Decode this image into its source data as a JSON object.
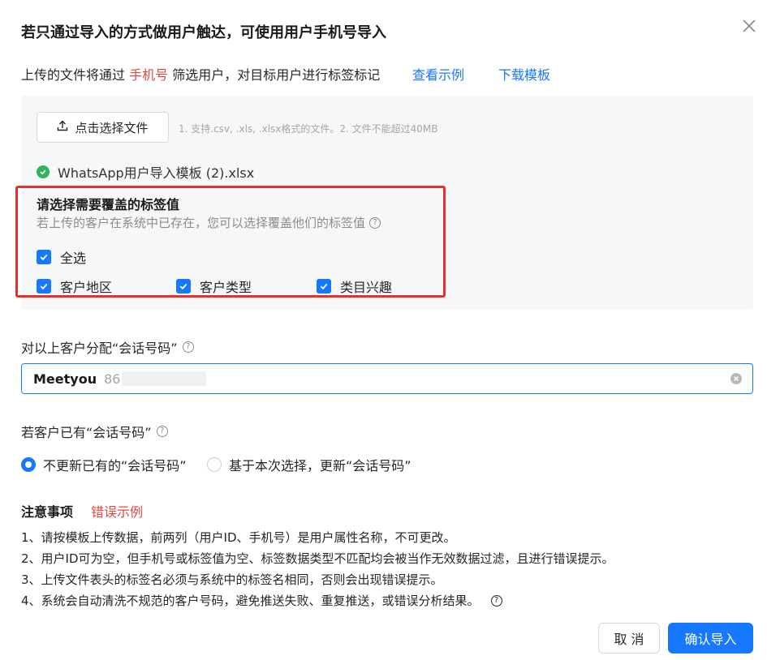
{
  "dialog": {
    "title": "若只通过导入的方式做用户触达，可使用用户手机号导入",
    "intro_prefix": "上传的文件将通过 ",
    "intro_highlight": "手机号",
    "intro_suffix": " 筛选用户，对目标用户进行标签标记",
    "view_example": "查看示例",
    "download_template": "下载模板"
  },
  "upload": {
    "button_label": "点击选择文件",
    "hint": "1. 支持.csv, .xls, .xlsx格式的文件。2. 文件不能超过40MB",
    "file_name": "WhatsApp用户导入模板 (2).xlsx"
  },
  "tags": {
    "title": "请选择需要覆盖的标签值",
    "description": "若上传的客户在系统中已存在，您可以选择覆盖他们的标签值",
    "select_all": "全选",
    "options": [
      "客户地区",
      "客户类型",
      "类目兴趣"
    ]
  },
  "assign": {
    "label": "对以上客户分配“会话号码”",
    "selected_name": "Meetyou",
    "selected_number_prefix": "86"
  },
  "existing": {
    "label": "若客户已有“会话号码”",
    "options": [
      "不更新已有的“会话号码”",
      "基于本次选择，更新“会话号码”"
    ],
    "selected_index": 0
  },
  "notes": {
    "title": "注意事项",
    "error_example": "错误示例",
    "items": [
      "1、请按模板上传数据，前两列（用户ID、手机号）是用户属性名称，不可更改。",
      "2、用户ID可为空，但手机号或标签值为空、标签数据类型不匹配均会被当作无效数据过滤，且进行错误提示。",
      "3、上传文件表头的标签名必须与系统中的标签名相同，否则会出现错误提示。",
      "4、系统会自动清洗不规范的客户号码，避免推送失败、重复推送，或错误分析结果。"
    ]
  },
  "footer": {
    "cancel": "取 消",
    "confirm": "确认导入"
  },
  "colors": {
    "primary": "#1677ff",
    "highlight_red": "#e5483b",
    "annotation_box": "#e8302a",
    "success": "#2fb35a"
  }
}
